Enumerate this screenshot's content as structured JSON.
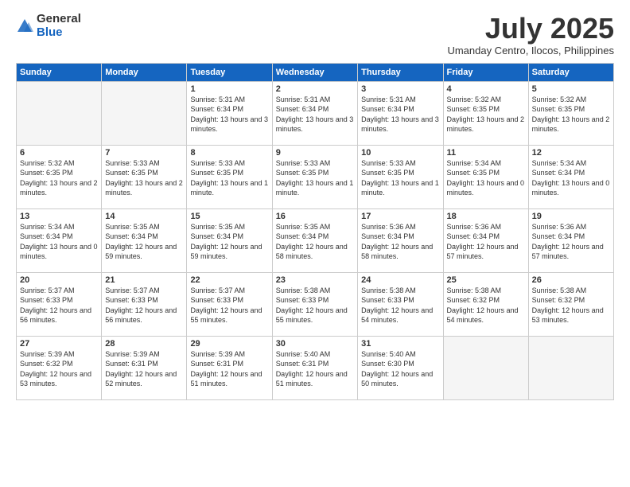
{
  "logo": {
    "general": "General",
    "blue": "Blue"
  },
  "title": "July 2025",
  "location": "Umanday Centro, Ilocos, Philippines",
  "days_of_week": [
    "Sunday",
    "Monday",
    "Tuesday",
    "Wednesday",
    "Thursday",
    "Friday",
    "Saturday"
  ],
  "weeks": [
    [
      {
        "num": "",
        "info": ""
      },
      {
        "num": "",
        "info": ""
      },
      {
        "num": "1",
        "info": "Sunrise: 5:31 AM\nSunset: 6:34 PM\nDaylight: 13 hours and 3 minutes."
      },
      {
        "num": "2",
        "info": "Sunrise: 5:31 AM\nSunset: 6:34 PM\nDaylight: 13 hours and 3 minutes."
      },
      {
        "num": "3",
        "info": "Sunrise: 5:31 AM\nSunset: 6:34 PM\nDaylight: 13 hours and 3 minutes."
      },
      {
        "num": "4",
        "info": "Sunrise: 5:32 AM\nSunset: 6:35 PM\nDaylight: 13 hours and 2 minutes."
      },
      {
        "num": "5",
        "info": "Sunrise: 5:32 AM\nSunset: 6:35 PM\nDaylight: 13 hours and 2 minutes."
      }
    ],
    [
      {
        "num": "6",
        "info": "Sunrise: 5:32 AM\nSunset: 6:35 PM\nDaylight: 13 hours and 2 minutes."
      },
      {
        "num": "7",
        "info": "Sunrise: 5:33 AM\nSunset: 6:35 PM\nDaylight: 13 hours and 2 minutes."
      },
      {
        "num": "8",
        "info": "Sunrise: 5:33 AM\nSunset: 6:35 PM\nDaylight: 13 hours and 1 minute."
      },
      {
        "num": "9",
        "info": "Sunrise: 5:33 AM\nSunset: 6:35 PM\nDaylight: 13 hours and 1 minute."
      },
      {
        "num": "10",
        "info": "Sunrise: 5:33 AM\nSunset: 6:35 PM\nDaylight: 13 hours and 1 minute."
      },
      {
        "num": "11",
        "info": "Sunrise: 5:34 AM\nSunset: 6:35 PM\nDaylight: 13 hours and 0 minutes."
      },
      {
        "num": "12",
        "info": "Sunrise: 5:34 AM\nSunset: 6:34 PM\nDaylight: 13 hours and 0 minutes."
      }
    ],
    [
      {
        "num": "13",
        "info": "Sunrise: 5:34 AM\nSunset: 6:34 PM\nDaylight: 13 hours and 0 minutes."
      },
      {
        "num": "14",
        "info": "Sunrise: 5:35 AM\nSunset: 6:34 PM\nDaylight: 12 hours and 59 minutes."
      },
      {
        "num": "15",
        "info": "Sunrise: 5:35 AM\nSunset: 6:34 PM\nDaylight: 12 hours and 59 minutes."
      },
      {
        "num": "16",
        "info": "Sunrise: 5:35 AM\nSunset: 6:34 PM\nDaylight: 12 hours and 58 minutes."
      },
      {
        "num": "17",
        "info": "Sunrise: 5:36 AM\nSunset: 6:34 PM\nDaylight: 12 hours and 58 minutes."
      },
      {
        "num": "18",
        "info": "Sunrise: 5:36 AM\nSunset: 6:34 PM\nDaylight: 12 hours and 57 minutes."
      },
      {
        "num": "19",
        "info": "Sunrise: 5:36 AM\nSunset: 6:34 PM\nDaylight: 12 hours and 57 minutes."
      }
    ],
    [
      {
        "num": "20",
        "info": "Sunrise: 5:37 AM\nSunset: 6:33 PM\nDaylight: 12 hours and 56 minutes."
      },
      {
        "num": "21",
        "info": "Sunrise: 5:37 AM\nSunset: 6:33 PM\nDaylight: 12 hours and 56 minutes."
      },
      {
        "num": "22",
        "info": "Sunrise: 5:37 AM\nSunset: 6:33 PM\nDaylight: 12 hours and 55 minutes."
      },
      {
        "num": "23",
        "info": "Sunrise: 5:38 AM\nSunset: 6:33 PM\nDaylight: 12 hours and 55 minutes."
      },
      {
        "num": "24",
        "info": "Sunrise: 5:38 AM\nSunset: 6:33 PM\nDaylight: 12 hours and 54 minutes."
      },
      {
        "num": "25",
        "info": "Sunrise: 5:38 AM\nSunset: 6:32 PM\nDaylight: 12 hours and 54 minutes."
      },
      {
        "num": "26",
        "info": "Sunrise: 5:38 AM\nSunset: 6:32 PM\nDaylight: 12 hours and 53 minutes."
      }
    ],
    [
      {
        "num": "27",
        "info": "Sunrise: 5:39 AM\nSunset: 6:32 PM\nDaylight: 12 hours and 53 minutes."
      },
      {
        "num": "28",
        "info": "Sunrise: 5:39 AM\nSunset: 6:31 PM\nDaylight: 12 hours and 52 minutes."
      },
      {
        "num": "29",
        "info": "Sunrise: 5:39 AM\nSunset: 6:31 PM\nDaylight: 12 hours and 51 minutes."
      },
      {
        "num": "30",
        "info": "Sunrise: 5:40 AM\nSunset: 6:31 PM\nDaylight: 12 hours and 51 minutes."
      },
      {
        "num": "31",
        "info": "Sunrise: 5:40 AM\nSunset: 6:30 PM\nDaylight: 12 hours and 50 minutes."
      },
      {
        "num": "",
        "info": ""
      },
      {
        "num": "",
        "info": ""
      }
    ]
  ]
}
